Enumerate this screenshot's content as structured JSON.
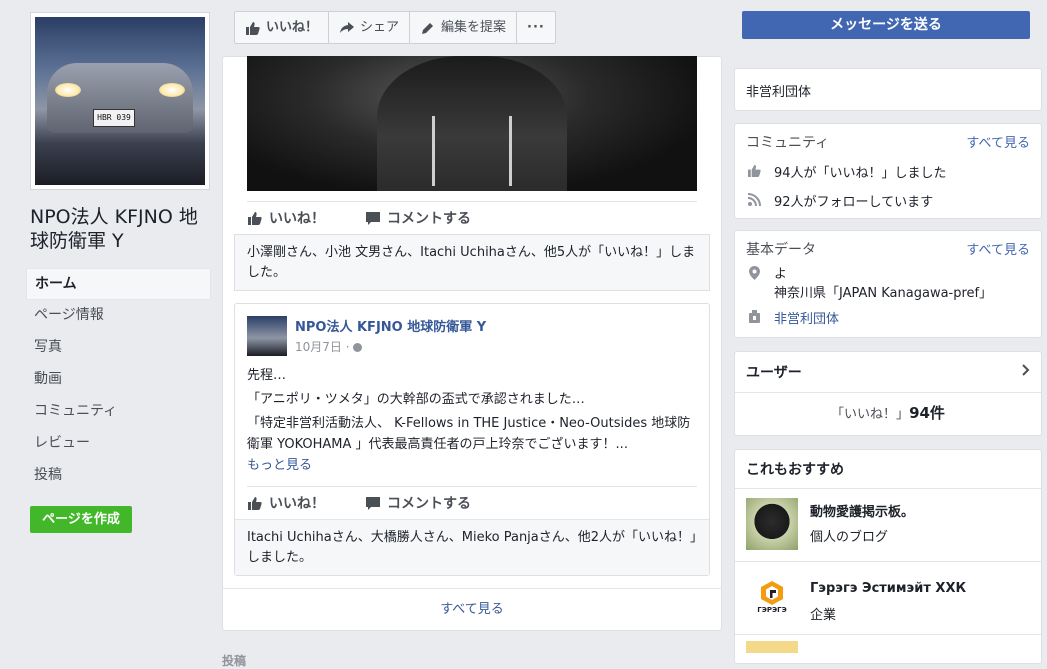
{
  "page": {
    "name": "NPO法人 KFJNO 地球防衛軍 Y",
    "plate_text": "HBR 039"
  },
  "leftnav": {
    "items": [
      {
        "label": "ホーム",
        "active": true
      },
      {
        "label": "ページ情報"
      },
      {
        "label": "写真"
      },
      {
        "label": "動画"
      },
      {
        "label": "コミュニティ"
      },
      {
        "label": "レビュー"
      },
      {
        "label": "投稿"
      }
    ],
    "create_page": "ページを作成"
  },
  "actionbar": {
    "like": "いいね！",
    "share": "シェア",
    "suggest_edit": "編集を提案",
    "more": "···"
  },
  "message_button": "メッセージを送る",
  "post1": {
    "like": "いいね！",
    "comment": "コメントする",
    "likes_text": "小澤剛さん、小池 文男さん、Itachi Uchihaさん、他5人が「いいね！」しました。"
  },
  "post2": {
    "author": "NPO法人 KFJNO 地球防衛軍 Y",
    "date": "10月7日 · ",
    "lines": [
      "先程…",
      "「アニポリ・ツメタ」の大幹部の盃式で承認されました…",
      "「特定非営利活動法人、 K-Fellows in THE Justice・Neo-Outsides 地球防衛軍 YOKOHAMA 」代表最高責任者の戸上玲奈でございます！..."
    ],
    "see_more": "もっと見る",
    "like": "いいね！",
    "comment": "コメントする",
    "likes_text": "Itachi Uchihaさん、大橋勝人さん、Mieko Panjaさん、他2人が「いいね！」しました。"
  },
  "mid_see_all": "すべて見る",
  "posts_label": "投稿",
  "right": {
    "category": "非営利団体",
    "community": {
      "title": "コミュニティ",
      "see_all": "すべて見る",
      "likes": "94人が「いいね！」しました",
      "follows": "92人がフォローしています"
    },
    "basic": {
      "title": "基本データ",
      "see_all": "すべて見る",
      "location_line1": "よ",
      "location_line2": "神奈川県「JAPAN Kanagawa-pref」",
      "category": "非営利団体"
    },
    "users": {
      "title": "ユーザー",
      "likes_prefix": "「いいね！」",
      "likes_count": "94件"
    },
    "suggest": {
      "title": "これもおすすめ",
      "items": [
        {
          "name": "動物愛護掲示板。",
          "type": "個人のブログ"
        },
        {
          "name": "Гэрэгэ Эстимэйт ХХК",
          "type": "企業"
        }
      ],
      "logo_text": "ГЭРЭГЭ"
    }
  }
}
